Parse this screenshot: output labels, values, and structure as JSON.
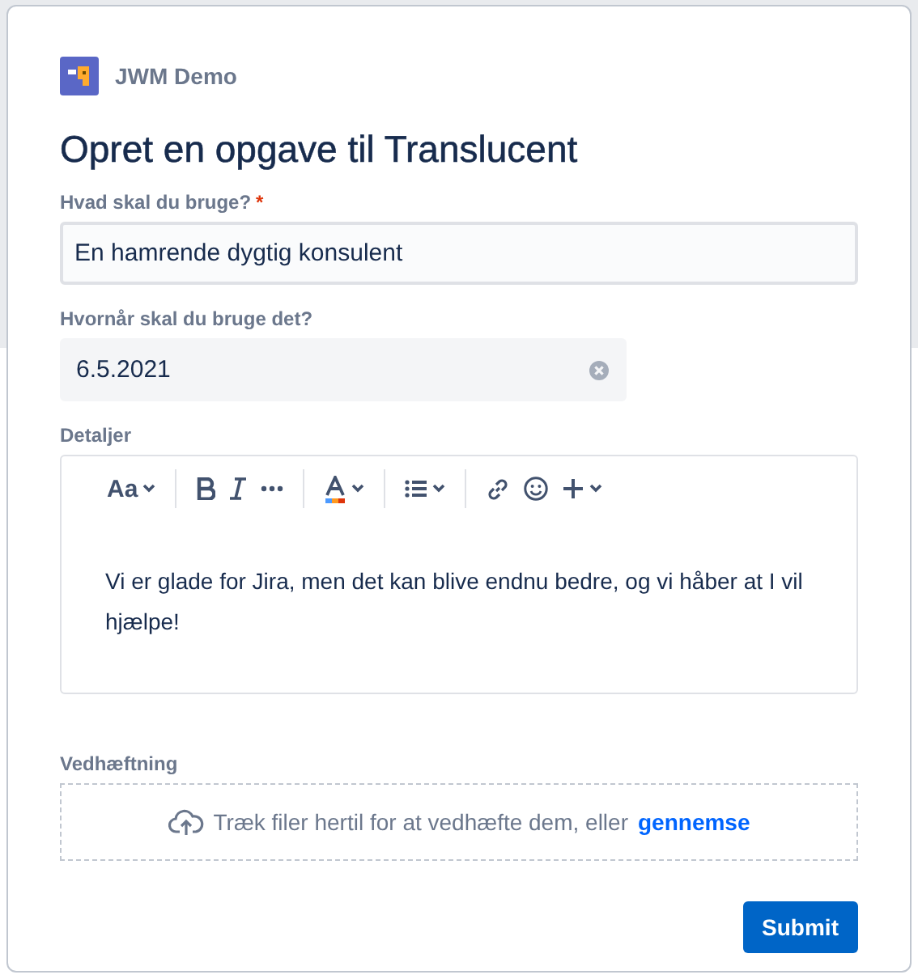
{
  "project": {
    "name": "JWM Demo"
  },
  "title": "Opret en opgave til Translucent",
  "fields": [
    {
      "kind": "text",
      "label": "Hvad skal du bruge?",
      "required_mark": "*",
      "value": "En hamrende dygtig konsulent"
    },
    {
      "kind": "date",
      "label": "Hvornår skal du bruge det?",
      "value": "6.5.2021"
    },
    {
      "kind": "editor",
      "label": "Detaljer",
      "text_style": "Aa",
      "value": "Vi er glade for Jira, men det kan blive endnu bedre, og vi håber at I vil hjælpe!"
    },
    {
      "kind": "attachment",
      "label": "Vedhæftning",
      "hint": "Træk filer hertil for at vedhæfte dem, eller",
      "link": "gennemse"
    }
  ],
  "submit": "Submit"
}
